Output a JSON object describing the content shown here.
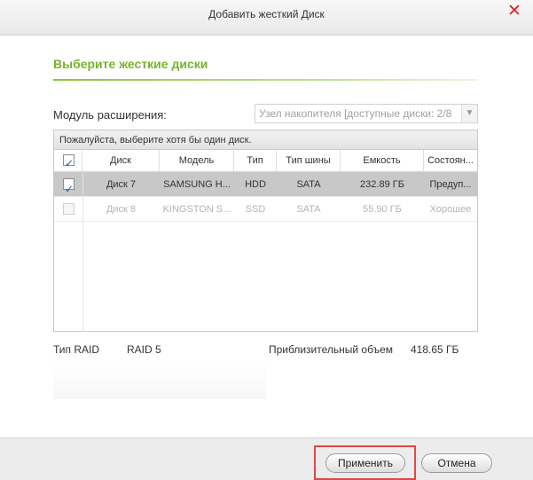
{
  "window": {
    "title": "Добавить жесткий Диск",
    "close_symbol": "✕",
    "close_icon": "close-icon",
    "accent_color": "#78b32b",
    "close_color": "#d62828"
  },
  "section": {
    "title": "Выберите жесткие диски"
  },
  "module": {
    "label": "Модуль расширения:",
    "value": "Узел накопителя [доступные диски: 2/8",
    "arrow_icon": "chevron-down-icon"
  },
  "grid": {
    "hint": "Пожалуйста, выберите хотя бы один диск.",
    "header_checked": true,
    "columns": [
      "Диск",
      "Модель",
      "Тип",
      "Тип шины",
      "Емкость",
      "Состоян..."
    ],
    "rows": [
      {
        "checked": true,
        "selected": true,
        "disabled": false,
        "cells": [
          "Диск 7",
          "SAMSUNG H...",
          "HDD",
          "SATA",
          "232.89 ГБ",
          "Предуп..."
        ]
      },
      {
        "checked": false,
        "selected": false,
        "disabled": true,
        "cells": [
          "Диск 8",
          "KINGSTON S...",
          "SSD",
          "SATA",
          "55.90 ГБ",
          "Хорошее"
        ]
      }
    ]
  },
  "summary": {
    "raid_type_label": "Тип RAID",
    "raid_type_value": "RAID 5",
    "approx_volume_label": "Приблизительный объем",
    "approx_volume_value": "418.65 ГБ"
  },
  "footer": {
    "apply_label": "Применить",
    "cancel_label": "Отмена",
    "highlight_color": "#e04848"
  }
}
